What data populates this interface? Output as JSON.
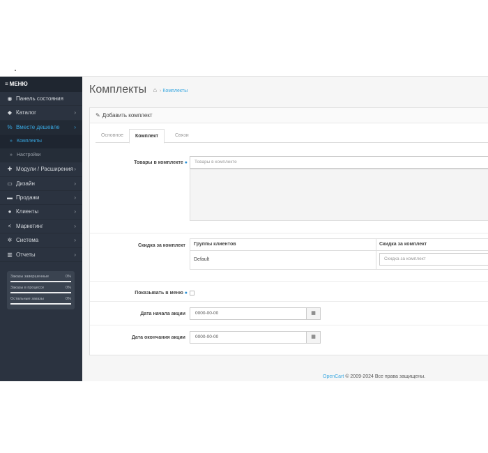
{
  "sidebar": {
    "menu_label": "МЕНЮ",
    "items": [
      {
        "label": "Панель состояния",
        "icon": "dashboard-icon",
        "glyph": "◉",
        "chevron": ""
      },
      {
        "label": "Каталог",
        "icon": "tag-icon",
        "glyph": "◆",
        "chevron": "›"
      },
      {
        "label": "Вместе дешевле",
        "icon": "percent-icon",
        "glyph": "%",
        "chevron": "›"
      },
      {
        "label": "Модули / Расширения",
        "icon": "puzzle-icon",
        "glyph": "✚",
        "chevron": "›"
      },
      {
        "label": "Дизайн",
        "icon": "monitor-icon",
        "glyph": "▭",
        "chevron": "›"
      },
      {
        "label": "Продажи",
        "icon": "cart-icon",
        "glyph": "▬",
        "chevron": "›"
      },
      {
        "label": "Клиенты",
        "icon": "user-icon",
        "glyph": "●",
        "chevron": "›"
      },
      {
        "label": "Маркетинг",
        "icon": "share-icon",
        "glyph": "<",
        "chevron": "›"
      },
      {
        "label": "Система",
        "icon": "gear-icon",
        "glyph": "✲",
        "chevron": "›"
      },
      {
        "label": "Отчеты",
        "icon": "bar-chart-icon",
        "glyph": "▥",
        "chevron": "›"
      }
    ],
    "subitems": [
      {
        "label": "Комплекты"
      },
      {
        "label": "Настройки"
      }
    ],
    "stats": [
      {
        "label": "Заказы завершенные",
        "percent": "0%",
        "fill": 0
      },
      {
        "label": "Заказы в процессе",
        "percent": "0%",
        "fill": 0
      },
      {
        "label": "Остальные заказы",
        "percent": "0%",
        "fill": 0
      }
    ]
  },
  "header": {
    "title": "Комплекты",
    "breadcrumb_sep": "›",
    "breadcrumb": "Комплекты"
  },
  "panel": {
    "title": "Добавить комплект",
    "tabs": [
      {
        "label": "Основное"
      },
      {
        "label": "Комплект"
      },
      {
        "label": "Связи"
      }
    ],
    "products_label": "Товары в комплекте",
    "products_placeholder": "Товары в комплекте",
    "discount_label": "Скидка за комплект",
    "discount_table": {
      "headers": [
        "Группы клиентов",
        "Скидка за комплект"
      ],
      "rows": [
        {
          "group": "Default",
          "placeholder": "Скидка за комплект"
        }
      ]
    },
    "show_in_menu_label": "Показывать в меню",
    "start_date_label": "Дата начала акции",
    "start_date_value": "0000-00-00",
    "end_date_label": "Дата окончания акции",
    "end_date_value": "0000-00-00"
  },
  "footer": {
    "brand": "OpenCart",
    "text": "© 2009-2024 Все права защищены."
  }
}
